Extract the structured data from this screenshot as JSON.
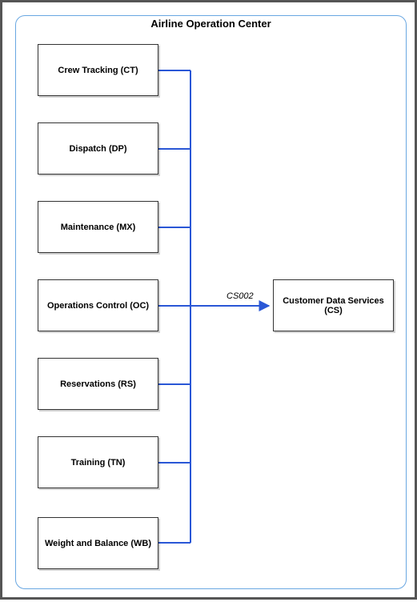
{
  "container": {
    "title": "Airline Operation Center"
  },
  "nodes": {
    "ct": "Crew Tracking (CT)",
    "dp": "Dispatch (DP)",
    "mx": "Maintenance (MX)",
    "oc": "Operations Control (OC)",
    "rs": "Reservations (RS)",
    "tn": "Training (TN)",
    "wb": "Weight and Balance (WB)",
    "cs": "Customer Data Services (CS)"
  },
  "edge": {
    "label": "CS002"
  },
  "chart_data": {
    "type": "diagram",
    "title": "Airline Operation Center",
    "container": "Airline Operation Center",
    "nodes": [
      {
        "id": "CT",
        "label": "Crew Tracking (CT)"
      },
      {
        "id": "DP",
        "label": "Dispatch (DP)"
      },
      {
        "id": "MX",
        "label": "Maintenance (MX)"
      },
      {
        "id": "OC",
        "label": "Operations Control (OC)"
      },
      {
        "id": "RS",
        "label": "Reservations (RS)"
      },
      {
        "id": "TN",
        "label": "Training (TN)"
      },
      {
        "id": "WB",
        "label": "Weight and Balance (WB)"
      },
      {
        "id": "CS",
        "label": "Customer Data Services (CS)"
      }
    ],
    "edges": [
      {
        "from": "CT",
        "to": "CS",
        "label": "CS002"
      },
      {
        "from": "DP",
        "to": "CS",
        "label": "CS002"
      },
      {
        "from": "MX",
        "to": "CS",
        "label": "CS002"
      },
      {
        "from": "OC",
        "to": "CS",
        "label": "CS002"
      },
      {
        "from": "RS",
        "to": "CS",
        "label": "CS002"
      },
      {
        "from": "TN",
        "to": "CS",
        "label": "CS002"
      },
      {
        "from": "WB",
        "to": "CS",
        "label": "CS002"
      }
    ]
  }
}
